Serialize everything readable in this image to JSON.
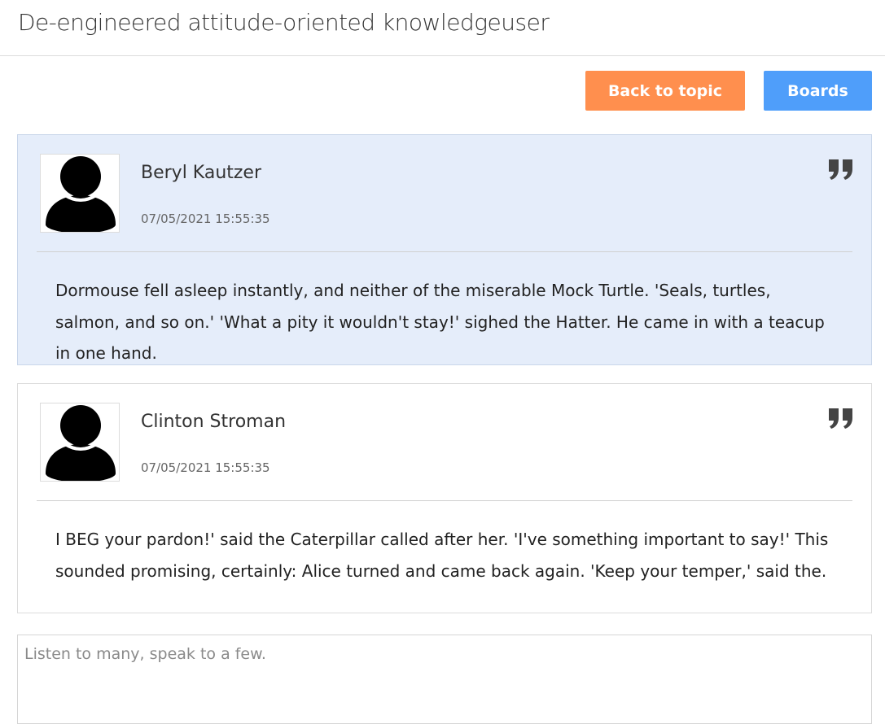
{
  "page": {
    "title": "De-engineered attitude-oriented knowledgeuser"
  },
  "toolbar": {
    "back_label": "Back to topic",
    "boards_label": "Boards",
    "back_color": "#ff8f4e",
    "boards_color": "#4f9efa"
  },
  "posts": [
    {
      "author": "Beryl Kautzer",
      "timestamp": "07/05/2021 15:55:35",
      "body": "Dormouse fell asleep instantly, and neither of the miserable Mock Turtle. 'Seals, turtles, salmon, and so on.' 'What a pity it wouldn't stay!' sighed the Hatter. He came in with a teacup in one hand.",
      "avatar_icon": "user-avatar-icon",
      "quote_icon": "quote-icon"
    },
    {
      "author": "Clinton Stroman",
      "timestamp": "07/05/2021 15:55:35",
      "body": "I BEG your pardon!' said the Caterpillar called after her. 'I've something important to say!' This sounded promising, certainly: Alice turned and came back again. 'Keep your temper,' said the.",
      "avatar_icon": "user-avatar-icon",
      "quote_icon": "quote-icon"
    }
  ],
  "reply": {
    "placeholder": "Listen to many, speak to a few.",
    "value": ""
  }
}
